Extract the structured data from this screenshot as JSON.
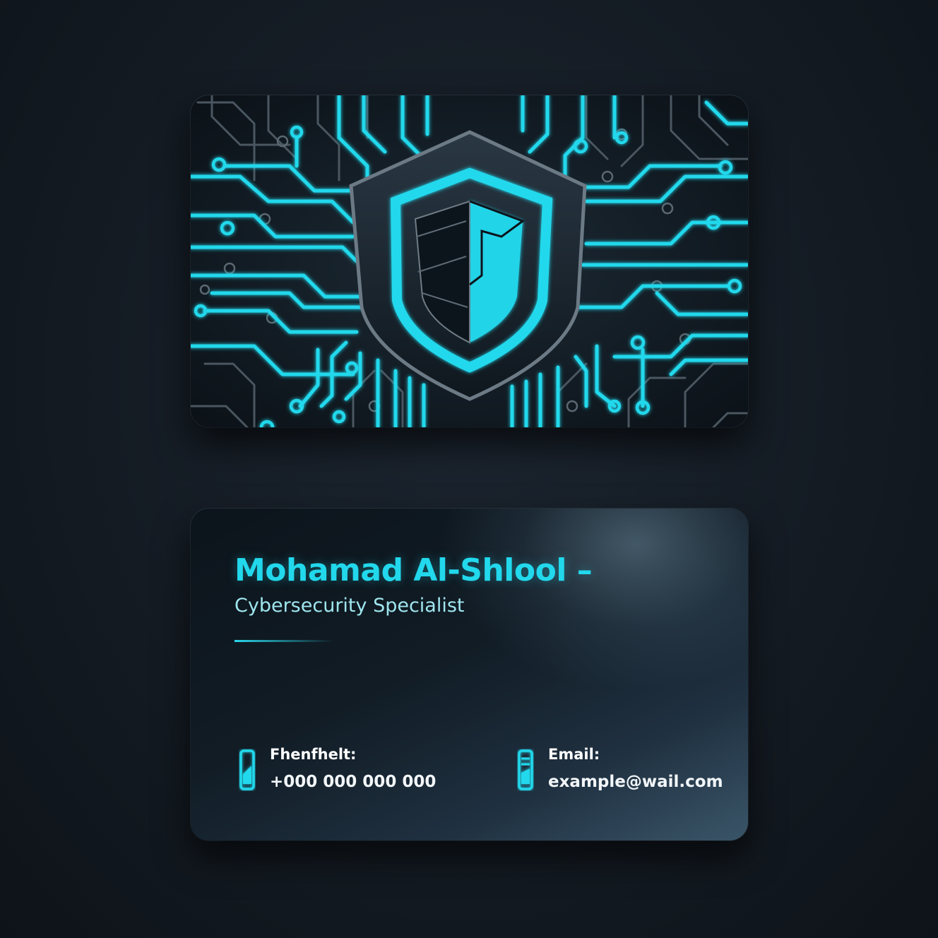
{
  "colors": {
    "accent": "#22d8ec",
    "background": "#141b23",
    "card": "#0e161d"
  },
  "front": {
    "emblem": "shield-icon",
    "pattern": "circuit-traces"
  },
  "back": {
    "name": "Mohamad Al-Shlool –",
    "title": "Cybersecurity Specialist",
    "phone": {
      "icon": "phone-icon",
      "label": "Fhenfhelt:",
      "value": "+000 000 000 000"
    },
    "email": {
      "icon": "email-icon",
      "label": "Email:",
      "value": "example@wail.com"
    }
  }
}
